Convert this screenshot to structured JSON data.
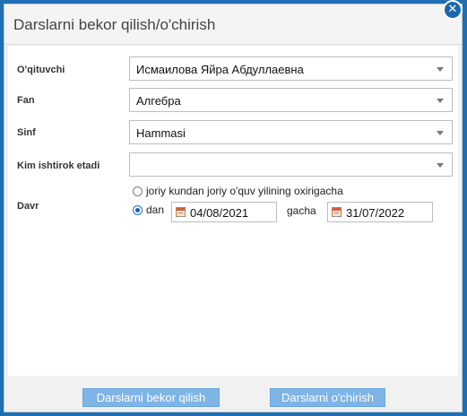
{
  "dialog": {
    "title": "Darslarni bekor qilish/o'chirish",
    "close_icon": "close-icon",
    "close_glyph": "✕"
  },
  "form": {
    "teacher": {
      "label": "O'qituvchi",
      "value": "Исмаилова Яйра Абдуллаевна"
    },
    "subject": {
      "label": "Fan",
      "value": "Алгебра"
    },
    "class": {
      "label": "Sinf",
      "value": "Hammasi"
    },
    "participants": {
      "label": "Kim ishtirok etadi",
      "value": ""
    },
    "period": {
      "label": "Davr",
      "option_until_year_end": "joriy kundan joriy o'quv yilining oxirigacha",
      "option_range": "dan",
      "selected": "option_range",
      "from_date": "04/08/2021",
      "to_label": "gacha",
      "to_date": "31/07/2022"
    }
  },
  "footer": {
    "cancel_lessons_label": "Darslarni bekor qilish",
    "delete_lessons_label": "Darslarni o'chirish"
  },
  "colors": {
    "background": "#1f6fb5",
    "button": "#7fb4e6",
    "radio_selected": "#1a62c7"
  }
}
